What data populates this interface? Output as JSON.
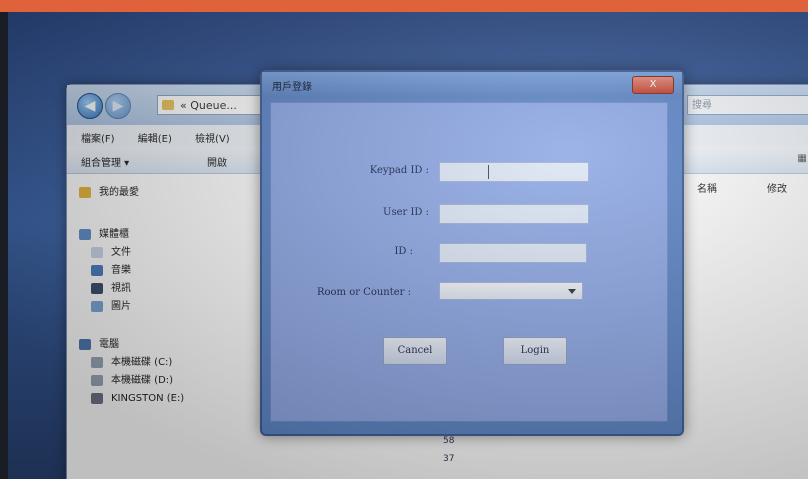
{
  "explorer": {
    "address": "« Queue...",
    "search_placeholder": "搜尋",
    "menu": [
      "檔案(F)",
      "編輯(E)",
      "檢視(V)"
    ],
    "toolbar": {
      "organize": "組合管理 ▾",
      "open": "開啟"
    },
    "sidebar": {
      "favorites": "我的最愛",
      "libraries": "媒體櫃",
      "lib_items": [
        "文件",
        "音樂",
        "視訊",
        "圖片"
      ],
      "computer": "電腦",
      "drives": [
        "本機磁碟 (C:)",
        "本機磁碟 (D:)",
        "KINGSTON (E:)"
      ]
    },
    "columns": {
      "col_a": "名稱",
      "col_b": "修改"
    },
    "rows": [
      "58",
      "37"
    ]
  },
  "dialog": {
    "title": "用戶登錄",
    "fields": {
      "keypad_label": "Keypad ID :",
      "user_label": "User ID :",
      "id_label": "ID :",
      "room_label": "Room or Counter :"
    },
    "cancel_label": "Cancel",
    "login_label": "Login",
    "close_label": "X"
  },
  "colors": {
    "accent_bar": "#e0623a",
    "dialog_bg": "#8fa9e6",
    "close_button": "#c2432f"
  }
}
